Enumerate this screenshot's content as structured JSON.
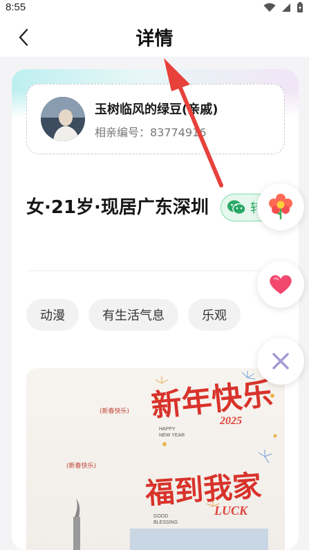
{
  "status_bar": {
    "time": "8:55"
  },
  "nav": {
    "title": "详情"
  },
  "matchmaker": {
    "name": "玉树临风的绿豆(亲戚)",
    "id_label": "相亲编号：",
    "id_value": "83774916"
  },
  "profile": {
    "headline": "女·21岁·现居广东深圳",
    "wechat_label": "转"
  },
  "tags": [
    "动漫",
    "有生活气息",
    "乐观"
  ],
  "poster": {
    "small_1": "(新春快乐)",
    "small_2": "(新春快乐)",
    "title_1": "新年快乐",
    "year": "2025",
    "happy_new_year": "HAPPY NEW YEAR",
    "title_2": "福到我家",
    "good_blessing": "GOOD BLESSING",
    "luck": "LUCK"
  },
  "actions": {
    "flower_icon": "flower-icon",
    "heart_icon": "heart-icon",
    "close_icon": "close-icon"
  },
  "colors": {
    "accent_green": "#2aa866",
    "heart_pink": "#f2476e",
    "close_lilac": "#a59ad6"
  }
}
